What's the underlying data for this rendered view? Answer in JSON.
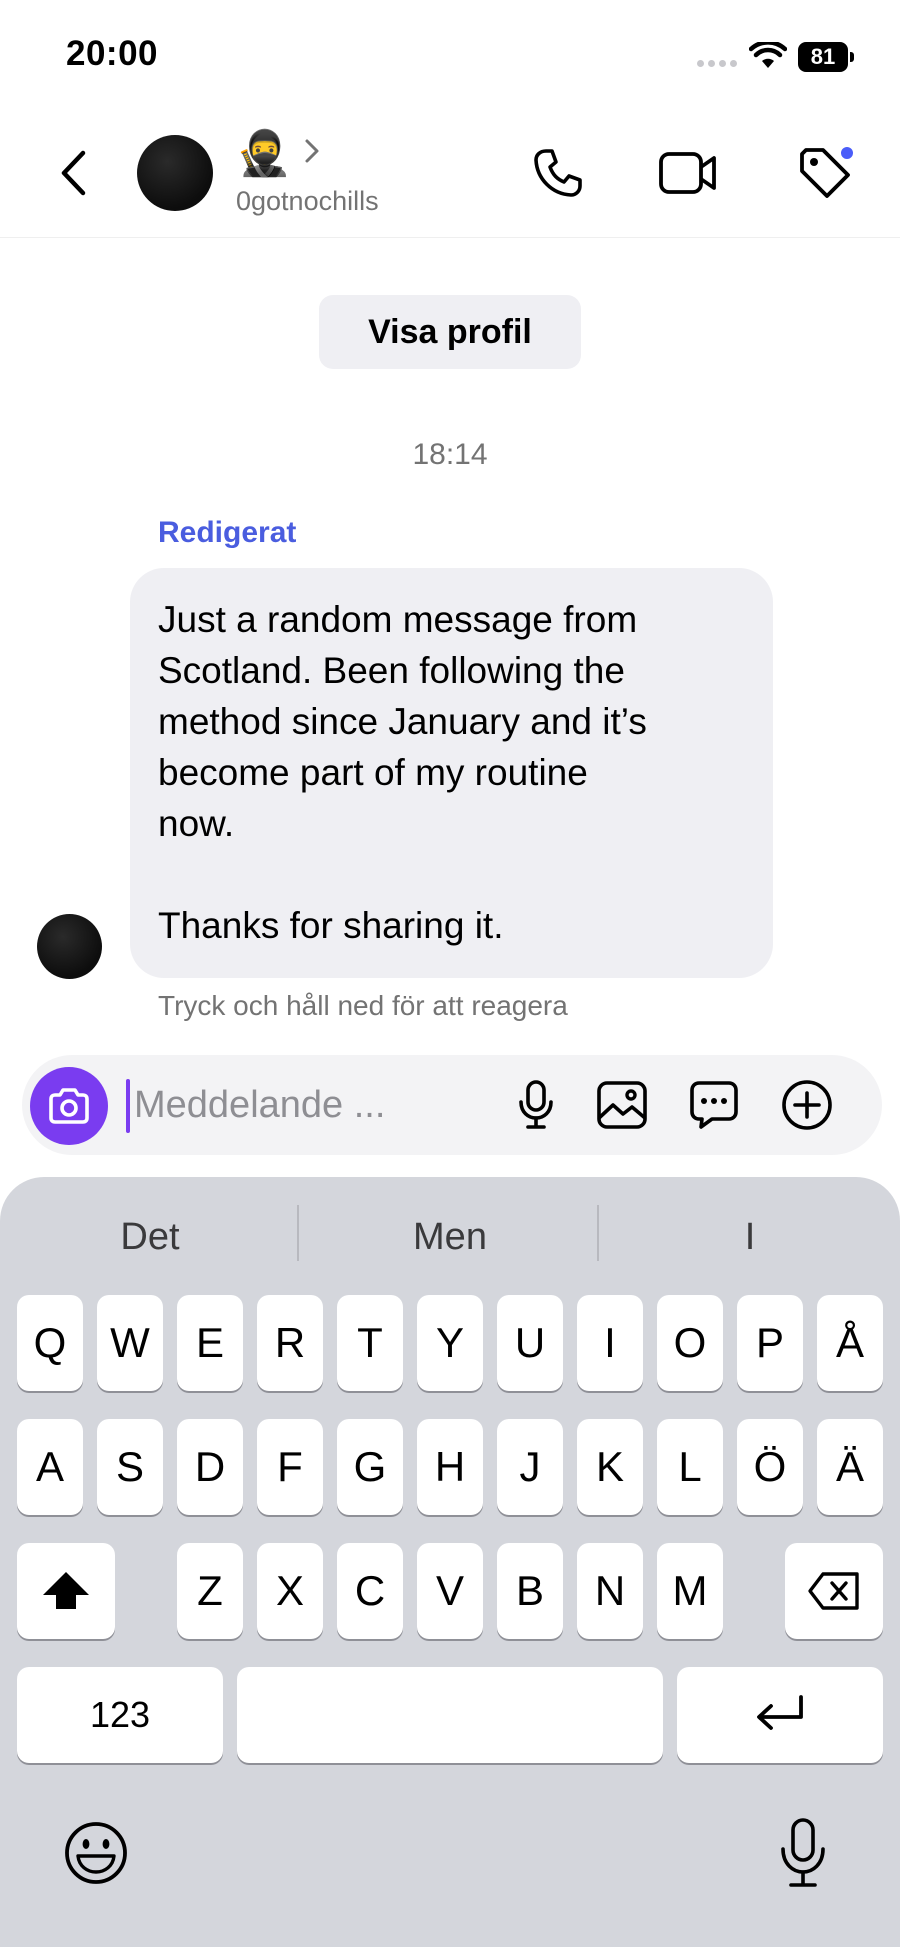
{
  "status_bar": {
    "time": "20:00",
    "battery": "81"
  },
  "header": {
    "emoji": "🥷",
    "username": "0gotnochills"
  },
  "conversation": {
    "profile_button": "Visa profil",
    "timestamp": "18:14",
    "edited_label": "Redigerat",
    "message": "Just a random message from\nScotland. Been following the\nmethod since January and it’s\nbecome part of my routine\nnow.\n\nThanks for sharing it.",
    "react_hint": "Tryck och håll ned för att reagera"
  },
  "composer": {
    "placeholder": "Meddelande ..."
  },
  "keyboard": {
    "suggestions": [
      "Det",
      "Men",
      "I"
    ],
    "row1": [
      "Q",
      "W",
      "E",
      "R",
      "T",
      "Y",
      "U",
      "I",
      "O",
      "P",
      "Å"
    ],
    "row2": [
      "A",
      "S",
      "D",
      "F",
      "G",
      "H",
      "J",
      "K",
      "L",
      "Ö",
      "Ä"
    ],
    "row3": [
      "Z",
      "X",
      "C",
      "V",
      "B",
      "N",
      "M"
    ],
    "numbers_key": "123"
  },
  "colors": {
    "accent": "#7a3cf0",
    "edited": "#4a5ddf",
    "notification_dot": "#4a5df9",
    "bubble": "#efeff3",
    "keyboard_bg": "#d4d6dc"
  },
  "icons": {
    "back": "chevron-left-icon",
    "call": "phone-icon",
    "video": "video-camera-icon",
    "tag": "tag-icon",
    "camera": "camera-icon",
    "mic": "microphone-icon",
    "gallery": "image-icon",
    "sticker": "chat-bubble-icon",
    "plus": "plus-circle-icon",
    "shift": "shift-icon",
    "backspace": "backspace-icon",
    "return": "return-icon",
    "emoji": "emoji-icon",
    "dictation": "microphone-icon"
  }
}
